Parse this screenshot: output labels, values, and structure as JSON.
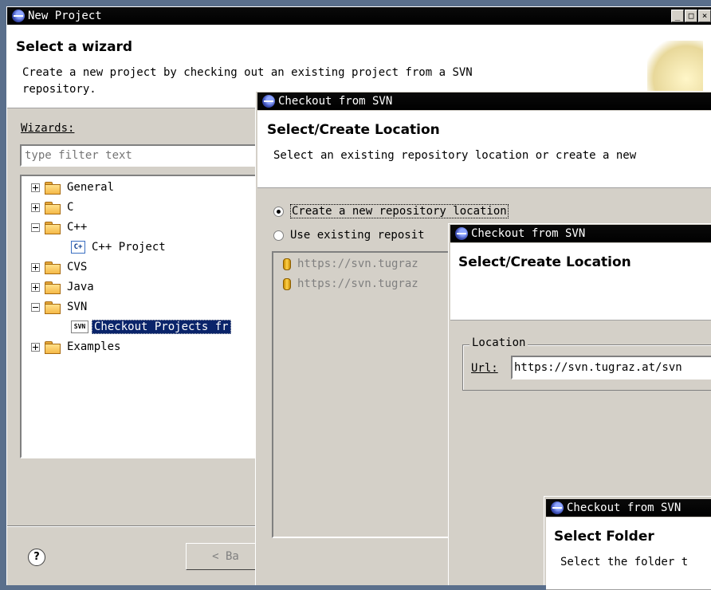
{
  "new_project": {
    "title": "New Project",
    "heading": "Select a wizard",
    "description_line1": "Create a new project by checking out an existing project from a SVN",
    "description_line2": "repository.",
    "wizards_label": "Wizards:",
    "filter_placeholder": "type filter text",
    "tree": [
      {
        "label": "General",
        "expanded": false
      },
      {
        "label": "C",
        "expanded": false
      },
      {
        "label": "C++",
        "expanded": true
      },
      {
        "label": "C++ Project",
        "child": true
      },
      {
        "label": "CVS",
        "expanded": false
      },
      {
        "label": "Java",
        "expanded": false
      },
      {
        "label": "SVN",
        "expanded": true
      },
      {
        "label": "Checkout Projects fr",
        "child": true,
        "selected": true
      },
      {
        "label": "Examples",
        "expanded": false
      }
    ],
    "help_icon": "?",
    "back_label": "< Ba"
  },
  "checkout1": {
    "title": "Checkout from SVN",
    "heading": "Select/Create Location",
    "description": "Select an existing repository location or create a new",
    "option_create": "Create a new repository location",
    "option_existing": "Use existing reposit",
    "repos": [
      "https://svn.tugraz",
      "https://svn.tugraz"
    ]
  },
  "checkout2": {
    "title": "Checkout from SVN",
    "heading": "Select/Create Location",
    "location_group": "Location",
    "url_label": "Url:",
    "url_value": "https://svn.tugraz.at/svn"
  },
  "checkout3": {
    "title": "Checkout from SVN",
    "heading": "Select Folder",
    "description": "Select the folder t"
  },
  "icons": {
    "eclipse": "eclipse-icon",
    "folder": "folder-icon",
    "repo": "repository-icon",
    "svn_wizard": "svn-wizard-icon",
    "cpp_project": "cpp-project-icon"
  },
  "colors": {
    "selection": "#0a246a",
    "dialog_bg": "#d4d0c8",
    "titlebar": "#000000"
  }
}
